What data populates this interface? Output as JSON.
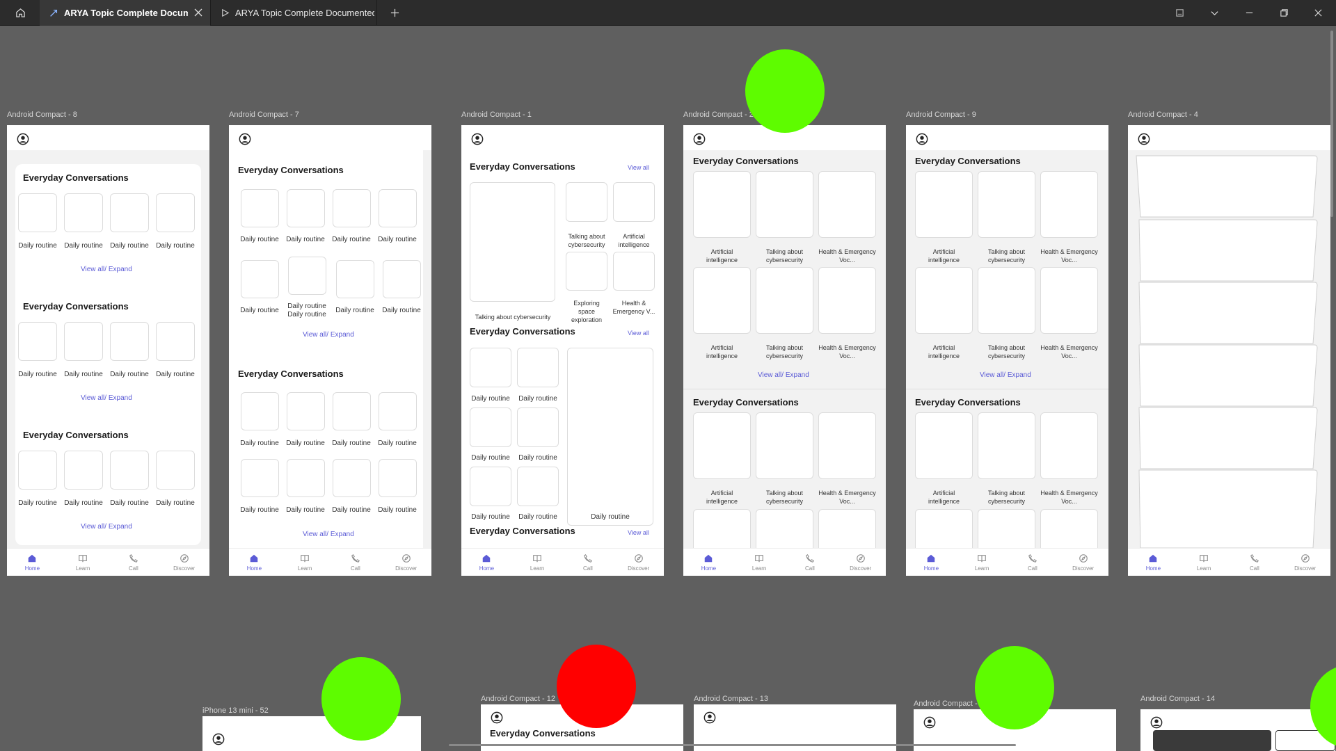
{
  "titlebar": {
    "tabs": [
      {
        "label": "ARYA Topic Complete Document",
        "icon": "figma-design-icon"
      },
      {
        "label": "ARYA Topic Complete Documented Fi",
        "icon": "play-prototype-icon"
      }
    ]
  },
  "frames": {
    "f8": {
      "label": "Android Compact - 8"
    },
    "f7": {
      "label": "Android Compact - 7"
    },
    "f1": {
      "label": "Android Compact - 1"
    },
    "f2": {
      "label": "Android Compact - 2"
    },
    "f9": {
      "label": "Android Compact - 9"
    },
    "f4": {
      "label": "Android Compact - 4"
    },
    "f52": {
      "label": "iPhone 13 mini - 52"
    },
    "f12": {
      "label": "Android Compact - 12"
    },
    "f13": {
      "label": "Android Compact - 13"
    },
    "f15": {
      "label": "Android Compact - 15"
    },
    "f14": {
      "label": "Android Compact - 14"
    }
  },
  "content": {
    "section_title": "Everyday Conversations",
    "view_all_expand": "View all/ Expand",
    "view_all": "View all",
    "daily_routine": "Daily routine",
    "talking_cyber": "Talking about cybersecurity",
    "talking_cyber_1": "Talking about",
    "talking_cyber_2": "cybersecurity",
    "ai_1": "Artificial",
    "ai_2": "intelligence",
    "health_1": "Health & Emergency",
    "health_2": "Voc...",
    "health_short": "Health &",
    "health_short_2": "Emergency V...",
    "space_1": "Exploring",
    "space_2": "space",
    "space_3": "exploration"
  },
  "nav": {
    "home": "Home",
    "learn": "Learn",
    "call": "Call",
    "discover": "Discover"
  },
  "colors": {
    "accent": "#5b5bd6",
    "canvas": "#5f5f5f",
    "green": "#5efc00",
    "red": "#ff0000"
  }
}
